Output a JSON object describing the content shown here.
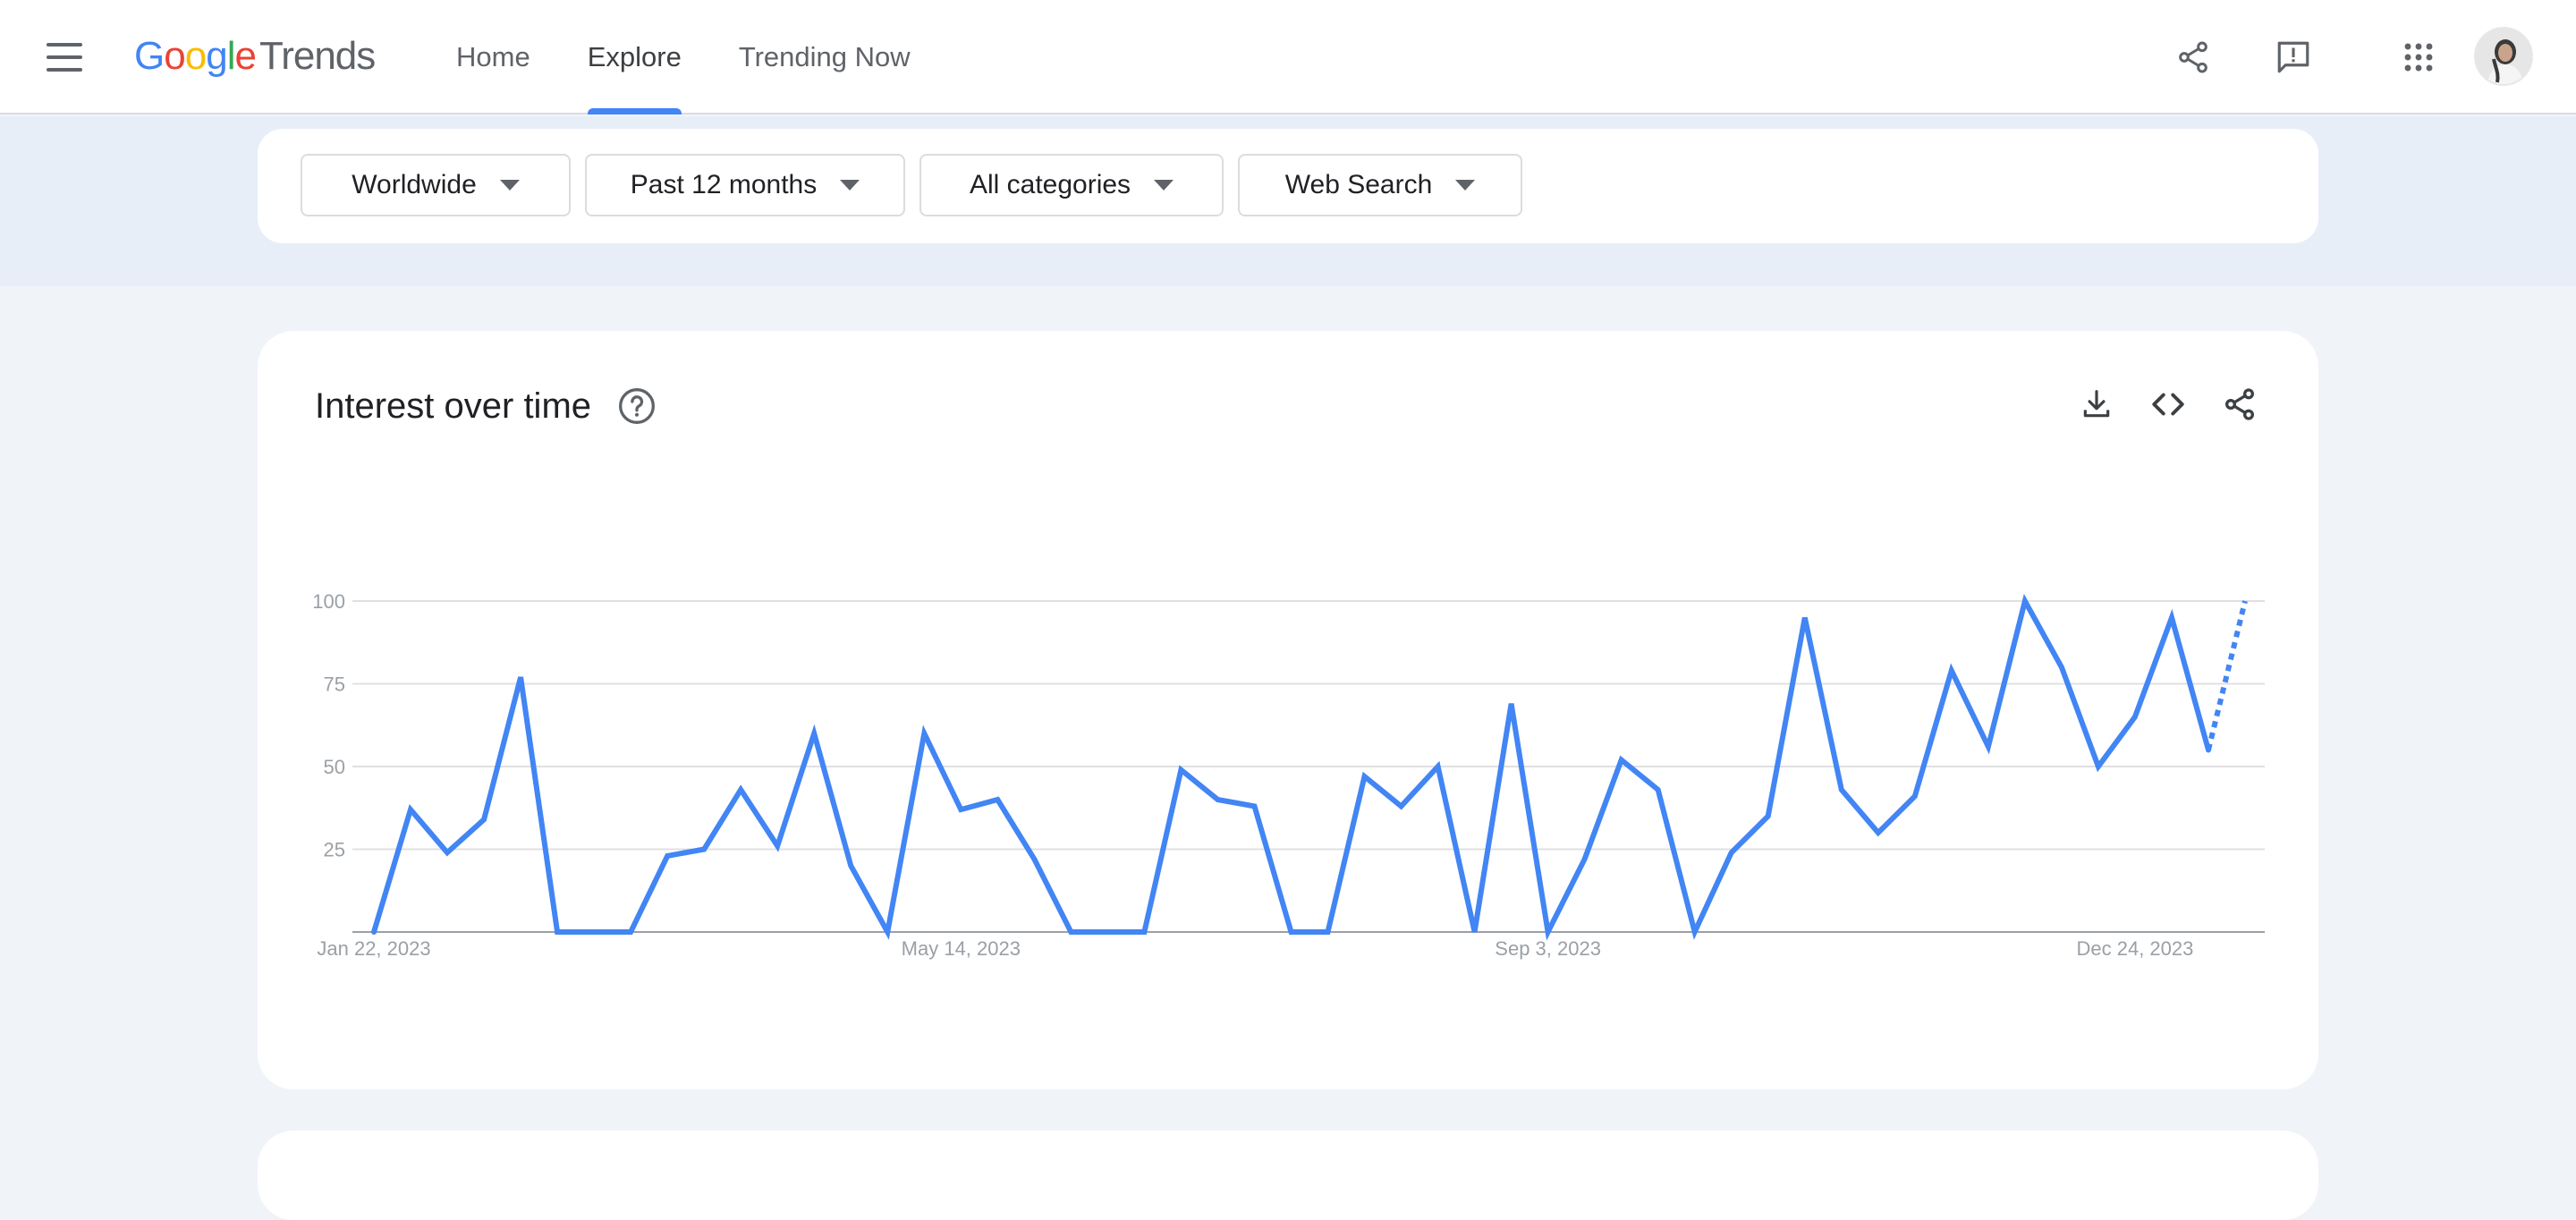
{
  "header": {
    "logo": {
      "google": [
        "G",
        "o",
        "o",
        "g",
        "l",
        "e"
      ],
      "google_colors": [
        "#4285f4",
        "#ea4335",
        "#fbbc05",
        "#4285f4",
        "#34a853",
        "#ea4335"
      ],
      "product": "Trends"
    },
    "nav": [
      {
        "label": "Home",
        "active": false
      },
      {
        "label": "Explore",
        "active": true
      },
      {
        "label": "Trending Now",
        "active": false
      }
    ],
    "icons": [
      "menu-icon",
      "share-icon",
      "feedback-icon",
      "apps-grid-icon",
      "avatar"
    ]
  },
  "filters": {
    "region": "Worldwide",
    "time_range": "Past 12 months",
    "category": "All categories",
    "search_type": "Web Search"
  },
  "chart_card": {
    "title": "Interest over time",
    "icons": [
      "help-icon",
      "download-icon",
      "embed-icon",
      "share-icon"
    ]
  },
  "colors": {
    "line": "#4285f4",
    "active_tab": "#4285f4",
    "grid": "#e0e0e0",
    "axis_text": "#9aa0a6"
  },
  "chart_data": {
    "type": "line",
    "x_tick_labels": [
      "Jan 22, 2023",
      "May 14, 2023",
      "Sep 3, 2023",
      "Dec 24, 2023"
    ],
    "y_ticks": [
      25,
      50,
      75,
      100
    ],
    "ylim": [
      0,
      100
    ],
    "grid": true,
    "x": [
      "Jan 22, 2023",
      "Jan 29, 2023",
      "Feb 5, 2023",
      "Feb 12, 2023",
      "Feb 19, 2023",
      "Feb 26, 2023",
      "Mar 5, 2023",
      "Mar 12, 2023",
      "Mar 19, 2023",
      "Mar 26, 2023",
      "Apr 2, 2023",
      "Apr 9, 2023",
      "Apr 16, 2023",
      "Apr 23, 2023",
      "Apr 30, 2023",
      "May 7, 2023",
      "May 14, 2023",
      "May 21, 2023",
      "May 28, 2023",
      "Jun 4, 2023",
      "Jun 11, 2023",
      "Jun 18, 2023",
      "Jun 25, 2023",
      "Jul 2, 2023",
      "Jul 9, 2023",
      "Jul 16, 2023",
      "Jul 23, 2023",
      "Jul 30, 2023",
      "Aug 6, 2023",
      "Aug 13, 2023",
      "Aug 20, 2023",
      "Aug 27, 2023",
      "Sep 3, 2023",
      "Sep 10, 2023",
      "Sep 17, 2023",
      "Sep 24, 2023",
      "Oct 1, 2023",
      "Oct 8, 2023",
      "Oct 15, 2023",
      "Oct 22, 2023",
      "Oct 29, 2023",
      "Nov 5, 2023",
      "Nov 12, 2023",
      "Nov 19, 2023",
      "Nov 26, 2023",
      "Dec 3, 2023",
      "Dec 10, 2023",
      "Dec 17, 2023",
      "Dec 24, 2023",
      "Dec 31, 2023",
      "Jan 7, 2024",
      "Jan 14, 2024",
      "Jan 21, 2024"
    ],
    "series": [
      {
        "values": [
          0,
          37,
          24,
          34,
          77,
          0,
          0,
          0,
          23,
          25,
          43,
          26,
          60,
          20,
          0,
          60,
          37,
          40,
          22,
          0,
          0,
          0,
          49,
          40,
          38,
          0,
          0,
          47,
          38,
          50,
          0,
          69,
          0,
          22,
          52,
          43,
          0,
          24,
          35,
          95,
          43,
          30,
          41,
          79,
          56,
          100,
          80,
          50,
          65,
          95,
          55,
          100
        ],
        "partial_last_point": true
      }
    ]
  }
}
